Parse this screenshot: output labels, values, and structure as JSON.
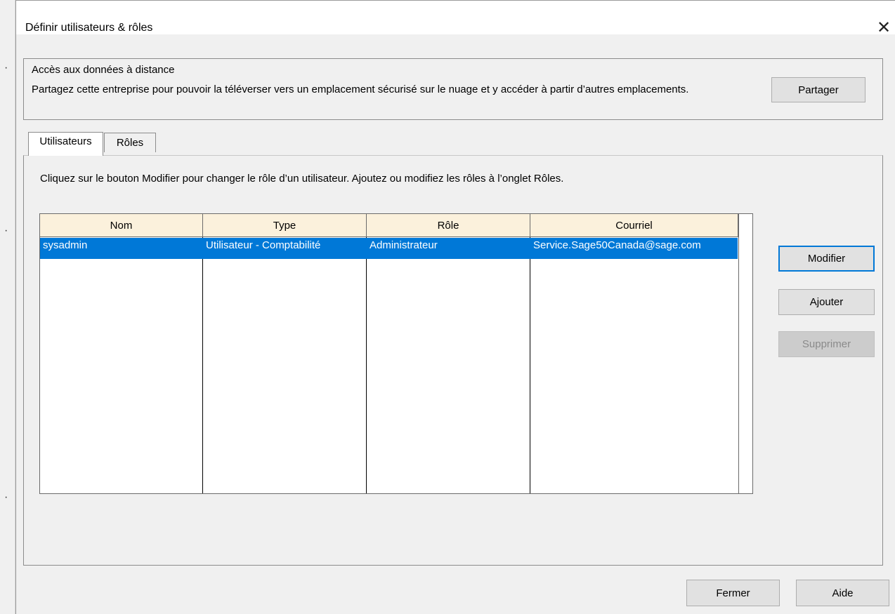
{
  "window": {
    "title": "Définir utilisateurs & rôles"
  },
  "remote": {
    "title": "Accès aux données à distance",
    "description": "Partagez cette entreprise pour pouvoir la téléverser vers un emplacement sécurisé sur le nuage et y accéder à partir d’autres emplacements.",
    "share_label": "Partager"
  },
  "tabs": [
    {
      "label": "Utilisateurs",
      "active": true
    },
    {
      "label": "Rôles",
      "active": false
    }
  ],
  "users_tab": {
    "instructions": "Cliquez sur le bouton Modifier pour changer le rôle d’un utilisateur. Ajoutez ou modifiez les rôles à l’onglet Rôles.",
    "columns": [
      "Nom",
      "Type",
      "Rôle",
      "Courriel"
    ],
    "rows": [
      {
        "name": "sysadmin",
        "type": "Utilisateur - Comptabilité",
        "role": "Administrateur",
        "email": "Service.Sage50Canada@sage.com",
        "selected": true
      }
    ],
    "buttons": {
      "modify": "Modifier",
      "add": "Ajouter",
      "delete": "Supprimer"
    }
  },
  "footer": {
    "close_label": "Fermer",
    "help_label": "Aide"
  },
  "colors": {
    "selection": "#0078d7",
    "header_bg": "#fbf1dc",
    "dialog_bg": "#f0f0f0"
  }
}
